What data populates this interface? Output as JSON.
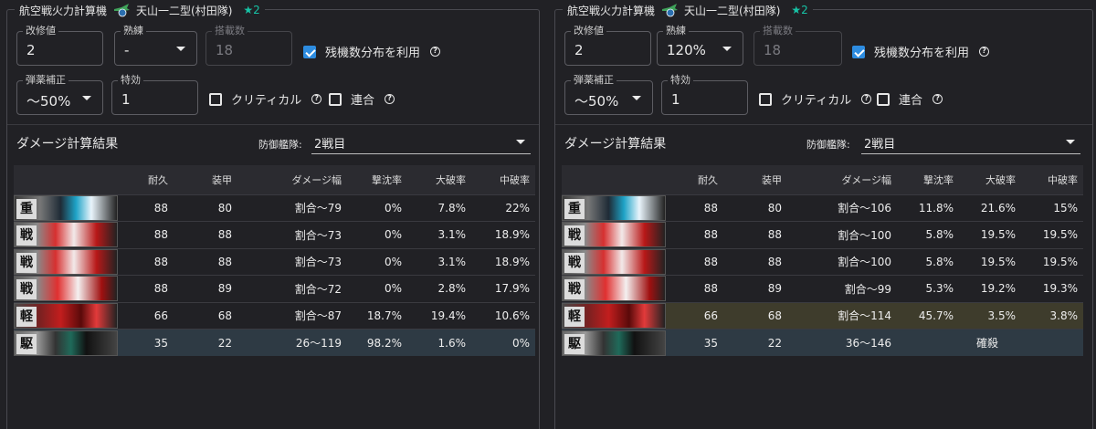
{
  "panels": [
    {
      "title": "航空戦火力計算機",
      "equip_name": "天山一二型(村田隊)",
      "star": "★2",
      "fields": {
        "kaishu_label": "改修値",
        "kaishu_value": "2",
        "jukuren_label": "熟練",
        "jukuren_value": "-",
        "tousai_label": "搭載数",
        "tousai_value": "18",
        "dan_label": "弾薬補正",
        "dan_value": "～50%",
        "tokko_label": "特効",
        "tokko_value": "1"
      },
      "checks": {
        "zanki_label": "残機数分布を利用",
        "zanki_checked": true,
        "critical_label": "クリティカル",
        "critical_checked": false,
        "rengo_label": "連合",
        "rengo_checked": false
      },
      "result_title": "ダメージ計算結果",
      "defense_label": "防御艦隊:",
      "defense_value": "2戦目",
      "headers": [
        "耐久",
        "装甲",
        "ダメージ幅",
        "撃沈率",
        "大破率",
        "中破率"
      ],
      "rows": [
        {
          "kanji": "重",
          "hp": "88",
          "armor": "80",
          "range": "割合～79",
          "sink": "0%",
          "taiha": "7.8%",
          "chuha": "22%"
        },
        {
          "kanji": "戦",
          "hp": "88",
          "armor": "88",
          "range": "割合～73",
          "sink": "0%",
          "taiha": "3.1%",
          "chuha": "18.9%"
        },
        {
          "kanji": "戦",
          "hp": "88",
          "armor": "88",
          "range": "割合～73",
          "sink": "0%",
          "taiha": "3.1%",
          "chuha": "18.9%"
        },
        {
          "kanji": "戦",
          "hp": "88",
          "armor": "89",
          "range": "割合～72",
          "sink": "0%",
          "taiha": "2.8%",
          "chuha": "17.9%"
        },
        {
          "kanji": "軽",
          "hp": "66",
          "armor": "68",
          "range": "割合～87",
          "sink": "18.7%",
          "taiha": "19.4%",
          "chuha": "10.6%"
        },
        {
          "kanji": "駆",
          "hp": "35",
          "armor": "22",
          "range": "26～119",
          "sink": "98.2%",
          "taiha": "1.6%",
          "chuha": "0%"
        }
      ]
    },
    {
      "title": "航空戦火力計算機",
      "equip_name": "天山一二型(村田隊)",
      "star": "★2",
      "fields": {
        "kaishu_label": "改修値",
        "kaishu_value": "2",
        "jukuren_label": "熟練",
        "jukuren_value": "120%",
        "tousai_label": "搭載数",
        "tousai_value": "18",
        "dan_label": "弾薬補正",
        "dan_value": "～50%",
        "tokko_label": "特効",
        "tokko_value": "1"
      },
      "checks": {
        "zanki_label": "残機数分布を利用",
        "zanki_checked": true,
        "critical_label": "クリティカル",
        "critical_checked": false,
        "rengo_label": "連合",
        "rengo_checked": false
      },
      "result_title": "ダメージ計算結果",
      "defense_label": "防御艦隊:",
      "defense_value": "2戦目",
      "headers": [
        "耐久",
        "装甲",
        "ダメージ幅",
        "撃沈率",
        "大破率",
        "中破率"
      ],
      "rows": [
        {
          "kanji": "重",
          "hp": "88",
          "armor": "80",
          "range": "割合～106",
          "sink": "11.8%",
          "taiha": "21.6%",
          "chuha": "15%"
        },
        {
          "kanji": "戦",
          "hp": "88",
          "armor": "88",
          "range": "割合～100",
          "sink": "5.8%",
          "taiha": "19.5%",
          "chuha": "19.5%"
        },
        {
          "kanji": "戦",
          "hp": "88",
          "armor": "88",
          "range": "割合～100",
          "sink": "5.8%",
          "taiha": "19.5%",
          "chuha": "19.5%"
        },
        {
          "kanji": "戦",
          "hp": "88",
          "armor": "89",
          "range": "割合～99",
          "sink": "5.3%",
          "taiha": "19.2%",
          "chuha": "19.3%"
        },
        {
          "kanji": "軽",
          "hp": "66",
          "armor": "68",
          "range": "割合～114",
          "sink": "45.7%",
          "taiha": "3.5%",
          "chuha": "3.8%"
        },
        {
          "kanji": "駆",
          "hp": "35",
          "armor": "22",
          "range": "36～146",
          "kill_label": "確殺"
        }
      ]
    }
  ]
}
